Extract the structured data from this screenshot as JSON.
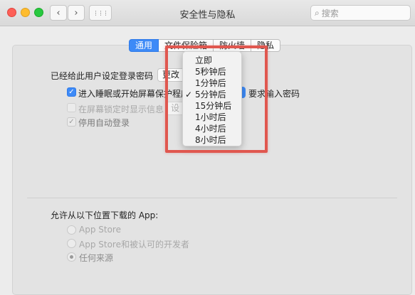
{
  "window": {
    "title": "安全性与隐私"
  },
  "search": {
    "placeholder": "搜索"
  },
  "tabs": [
    "通用",
    "文件保险箱",
    "防火墙",
    "隐私"
  ],
  "general": {
    "password_label": "已经给此用户设定登录密码",
    "change_password_button": "更改",
    "require_password_label": "进入睡眠或开始屏幕保护程序",
    "require_password_suffix": "要求输入密码",
    "lock_message_label": "在屏幕锁定时显示信息",
    "lock_message_button": "设",
    "disable_auto_login_label": "停用自动登录"
  },
  "popup_menu": {
    "items": [
      "立即",
      "5秒钟后",
      "1分钟后",
      "5分钟后",
      "15分钟后",
      "1小时后",
      "4小时后",
      "8小时后"
    ],
    "selected_index": 3,
    "check_glyph": "✓"
  },
  "downloads": {
    "title": "允许从以下位置下载的 App:",
    "options": [
      "App Store",
      "App Store和被认可的开发者",
      "任何来源"
    ],
    "selected_index": 2
  },
  "colors": {
    "accent": "#3d8af7",
    "highlight_border": "#e0574f"
  },
  "icons": {
    "back": "‹",
    "forward": "›",
    "grid": "⋮⋮⋮",
    "search": "⌕"
  }
}
